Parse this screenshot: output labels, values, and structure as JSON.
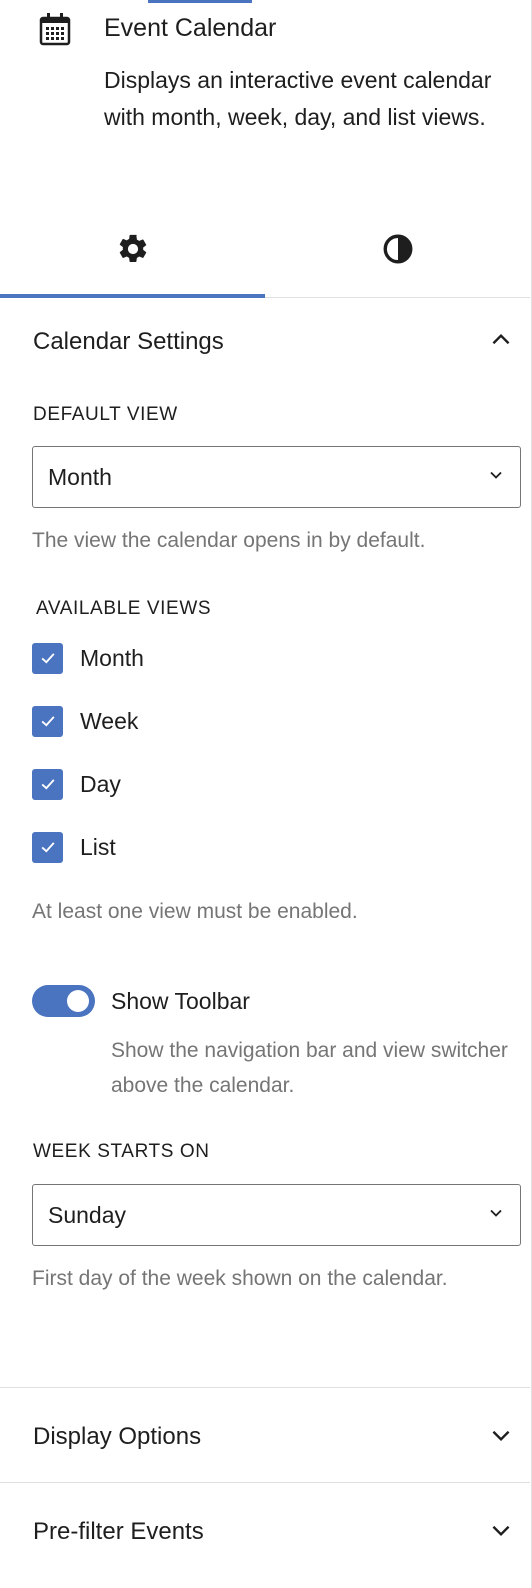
{
  "block": {
    "title": "Event Calendar",
    "description": "Displays an interactive event calendar with month, week, day, and list views.",
    "icon": "calendar-icon"
  },
  "tabs": [
    {
      "icon": "gear-icon",
      "active": true
    },
    {
      "icon": "contrast-icon",
      "active": false
    }
  ],
  "calendar_settings": {
    "title": "Calendar Settings",
    "expanded": true,
    "default_view": {
      "label": "DEFAULT VIEW",
      "value": "Month",
      "help": "The view the calendar opens in by default."
    },
    "available_views": {
      "label": "AVAILABLE VIEWS",
      "items": [
        {
          "label": "Month",
          "checked": true
        },
        {
          "label": "Week",
          "checked": true
        },
        {
          "label": "Day",
          "checked": true
        },
        {
          "label": "List",
          "checked": true
        }
      ],
      "help": "At least one view must be enabled."
    },
    "show_toolbar": {
      "label": "Show Toolbar",
      "enabled": true,
      "help": "Show the navigation bar and view switcher above the calendar."
    },
    "week_starts_on": {
      "label": "WEEK STARTS ON",
      "value": "Sunday",
      "help": "First day of the week shown on the calendar."
    }
  },
  "display_options": {
    "title": "Display Options",
    "expanded": false
  },
  "prefilter_events": {
    "title": "Pre-filter Events",
    "expanded": false
  },
  "colors": {
    "accent": "#4a74c0",
    "text": "#1e1e1e",
    "muted": "#757575",
    "border": "#e0e0e0"
  }
}
